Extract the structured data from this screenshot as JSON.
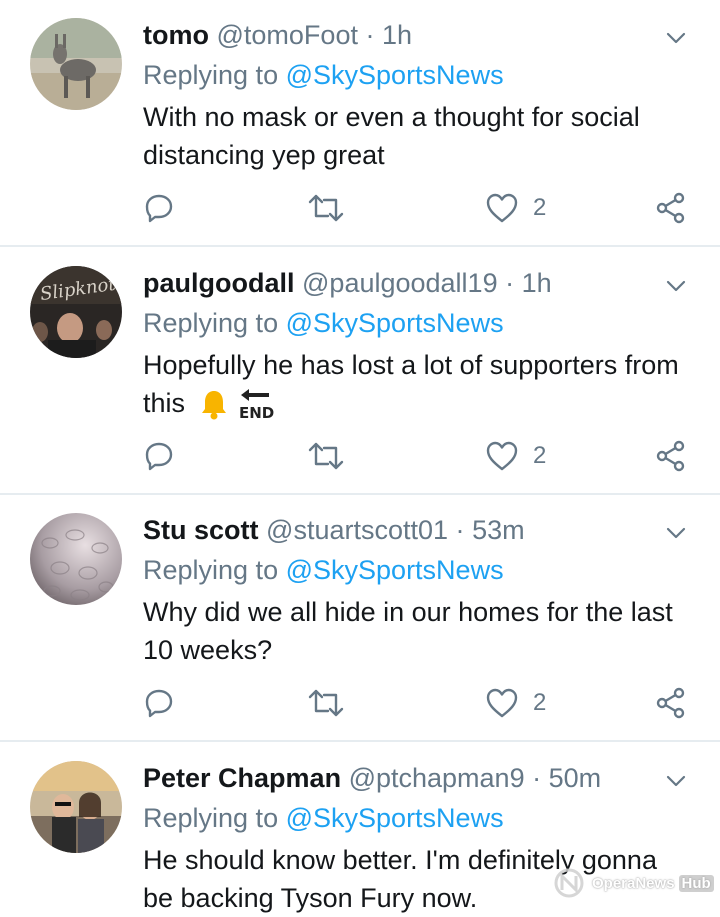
{
  "tweets": [
    {
      "name": "tomo",
      "handle": "@tomoFoot",
      "dot": "·",
      "time": "1h",
      "replying_prefix": "Replying to",
      "mention": "@SkySportsNews",
      "text": "With no mask or even a thought for social distancing yep great",
      "like_count": "2",
      "avatar_icon": "donkey-photo"
    },
    {
      "name": "paulgoodall",
      "handle": "@paulgoodall19",
      "dot": "·",
      "time": "1h",
      "replying_prefix": "Replying to",
      "mention": "@SkySportsNews",
      "text": "Hopefully he has lost a lot of supporters from this",
      "emoji": [
        "bell-emoji",
        "end-arrow-emoji"
      ],
      "like_count": "2",
      "avatar_icon": "slipknot-photo"
    },
    {
      "name": "Stu scott",
      "handle": "@stuartscott01",
      "dot": "·",
      "time": "53m",
      "replying_prefix": "Replying to",
      "mention": "@SkySportsNews",
      "text": "Why did we all hide in our homes for the last 10 weeks?",
      "like_count": "2",
      "avatar_icon": "textured-photo"
    },
    {
      "name": "Peter Chapman",
      "handle": "@ptchapman9",
      "dot": "·",
      "time": "50m",
      "replying_prefix": "Replying to",
      "mention": "@SkySportsNews",
      "text": "He should know better. I'm definitely gonna be backing Tyson Fury now.",
      "avatar_icon": "couple-photo"
    }
  ],
  "watermark": {
    "text": "OperaNews",
    "hub": "Hub"
  },
  "colors": {
    "link": "#1da1f2",
    "secondary": "#657786",
    "text": "#14171a",
    "divider": "#e6ecf0"
  }
}
